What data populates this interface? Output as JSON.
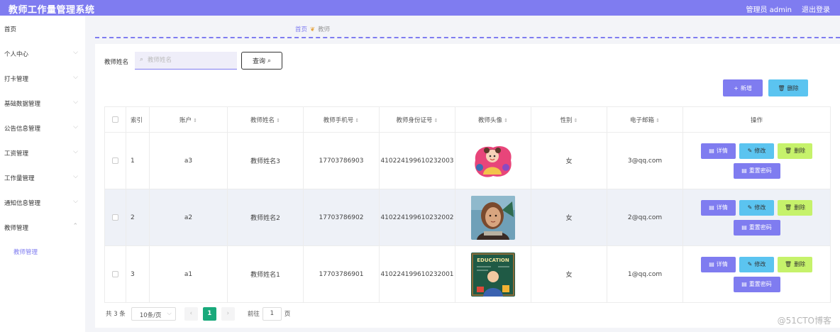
{
  "header": {
    "app_title": "教师工作量管理系统",
    "user_label": "管理员 admin",
    "logout_label": "退出登录"
  },
  "sidebar": {
    "items": [
      {
        "label": "首页",
        "has_chevron": false
      },
      {
        "label": "个人中心",
        "has_chevron": true
      },
      {
        "label": "打卡管理",
        "has_chevron": true
      },
      {
        "label": "基础数据管理",
        "has_chevron": true
      },
      {
        "label": "公告信息管理",
        "has_chevron": true
      },
      {
        "label": "工资管理",
        "has_chevron": true
      },
      {
        "label": "工作量管理",
        "has_chevron": true
      },
      {
        "label": "通知信息管理",
        "has_chevron": true
      },
      {
        "label": "教师管理",
        "has_chevron": true,
        "expanded": true
      }
    ],
    "active_sub_item": "教师管理"
  },
  "breadcrumb": {
    "home": "首页",
    "current": "教师"
  },
  "search": {
    "label": "教师姓名",
    "placeholder": "教师姓名",
    "value": "",
    "query_label": "查询"
  },
  "toolbar": {
    "add_label": "新增",
    "delete_label": "删除"
  },
  "table": {
    "columns": [
      "索引",
      "账户",
      "教师姓名",
      "教师手机号",
      "教师身份证号",
      "教师头像",
      "性别",
      "电子邮箱",
      "操作"
    ],
    "rows": [
      {
        "index": "1",
        "account": "a3",
        "name": "教师姓名3",
        "phone": "17703786903",
        "id_number": "410224199610232003",
        "gender": "女",
        "email": "3@qq.com",
        "avatar": "cartoon-girl-avatar"
      },
      {
        "index": "2",
        "account": "a2",
        "name": "教师姓名2",
        "phone": "17703786902",
        "id_number": "410224199610232002",
        "gender": "女",
        "email": "2@qq.com",
        "avatar": "woman-portrait-avatar"
      },
      {
        "index": "3",
        "account": "a1",
        "name": "教师姓名1",
        "phone": "17703786901",
        "id_number": "410224199610232001",
        "gender": "女",
        "email": "1@qq.com",
        "avatar": "education-chalkboard-avatar"
      }
    ],
    "row_actions": {
      "detail": "详情",
      "edit": "修改",
      "delete": "删除",
      "reset_password": "重置密码"
    },
    "avatar_text": "EDUCATION"
  },
  "pagination": {
    "total": "共 3 条",
    "page_size": "10条/页",
    "current_page": "1",
    "goto_label": "前往",
    "goto_value": "1",
    "page_unit": "页"
  },
  "watermark": "@51CTO博客",
  "colors": {
    "primary": "#7f7cf0",
    "info": "#5bc4f0",
    "warning_green": "#c6f26b",
    "page_active": "#19a97b"
  }
}
